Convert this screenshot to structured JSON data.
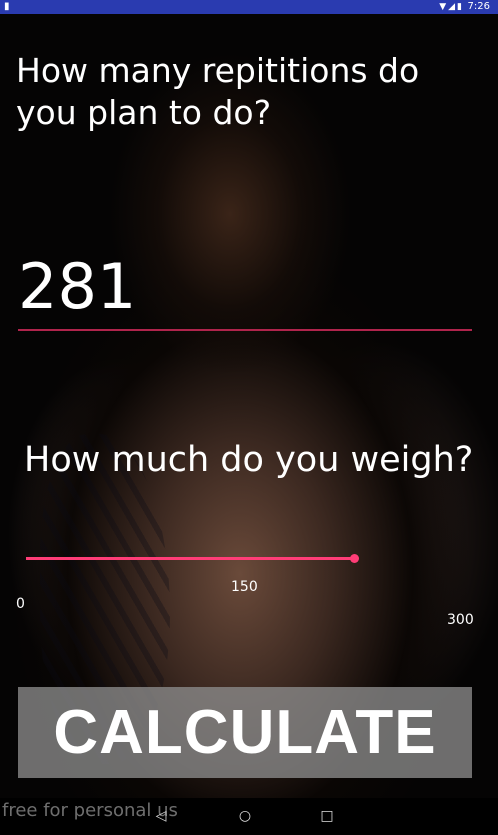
{
  "status_bar": {
    "time": "7:26",
    "left_icon": "sim-card-icon",
    "right_icons": "▼◢▮"
  },
  "reps_section": {
    "question": "How many repititions do you plan to do?",
    "value": "281"
  },
  "weight_section": {
    "question": "How much do you weigh?",
    "slider": {
      "min_label": "0",
      "mid_label": "150",
      "max_label": "300",
      "fill_fraction": 0.66
    }
  },
  "calculate_button": {
    "label": "CALCULATE"
  },
  "watermark": "free for personal us",
  "nav_bar": {
    "back": "◁",
    "home": "○",
    "recent": "□"
  },
  "colors": {
    "accent": "#ff3d77",
    "status_bar": "#2a3bb0",
    "underline": "#b0244c"
  }
}
